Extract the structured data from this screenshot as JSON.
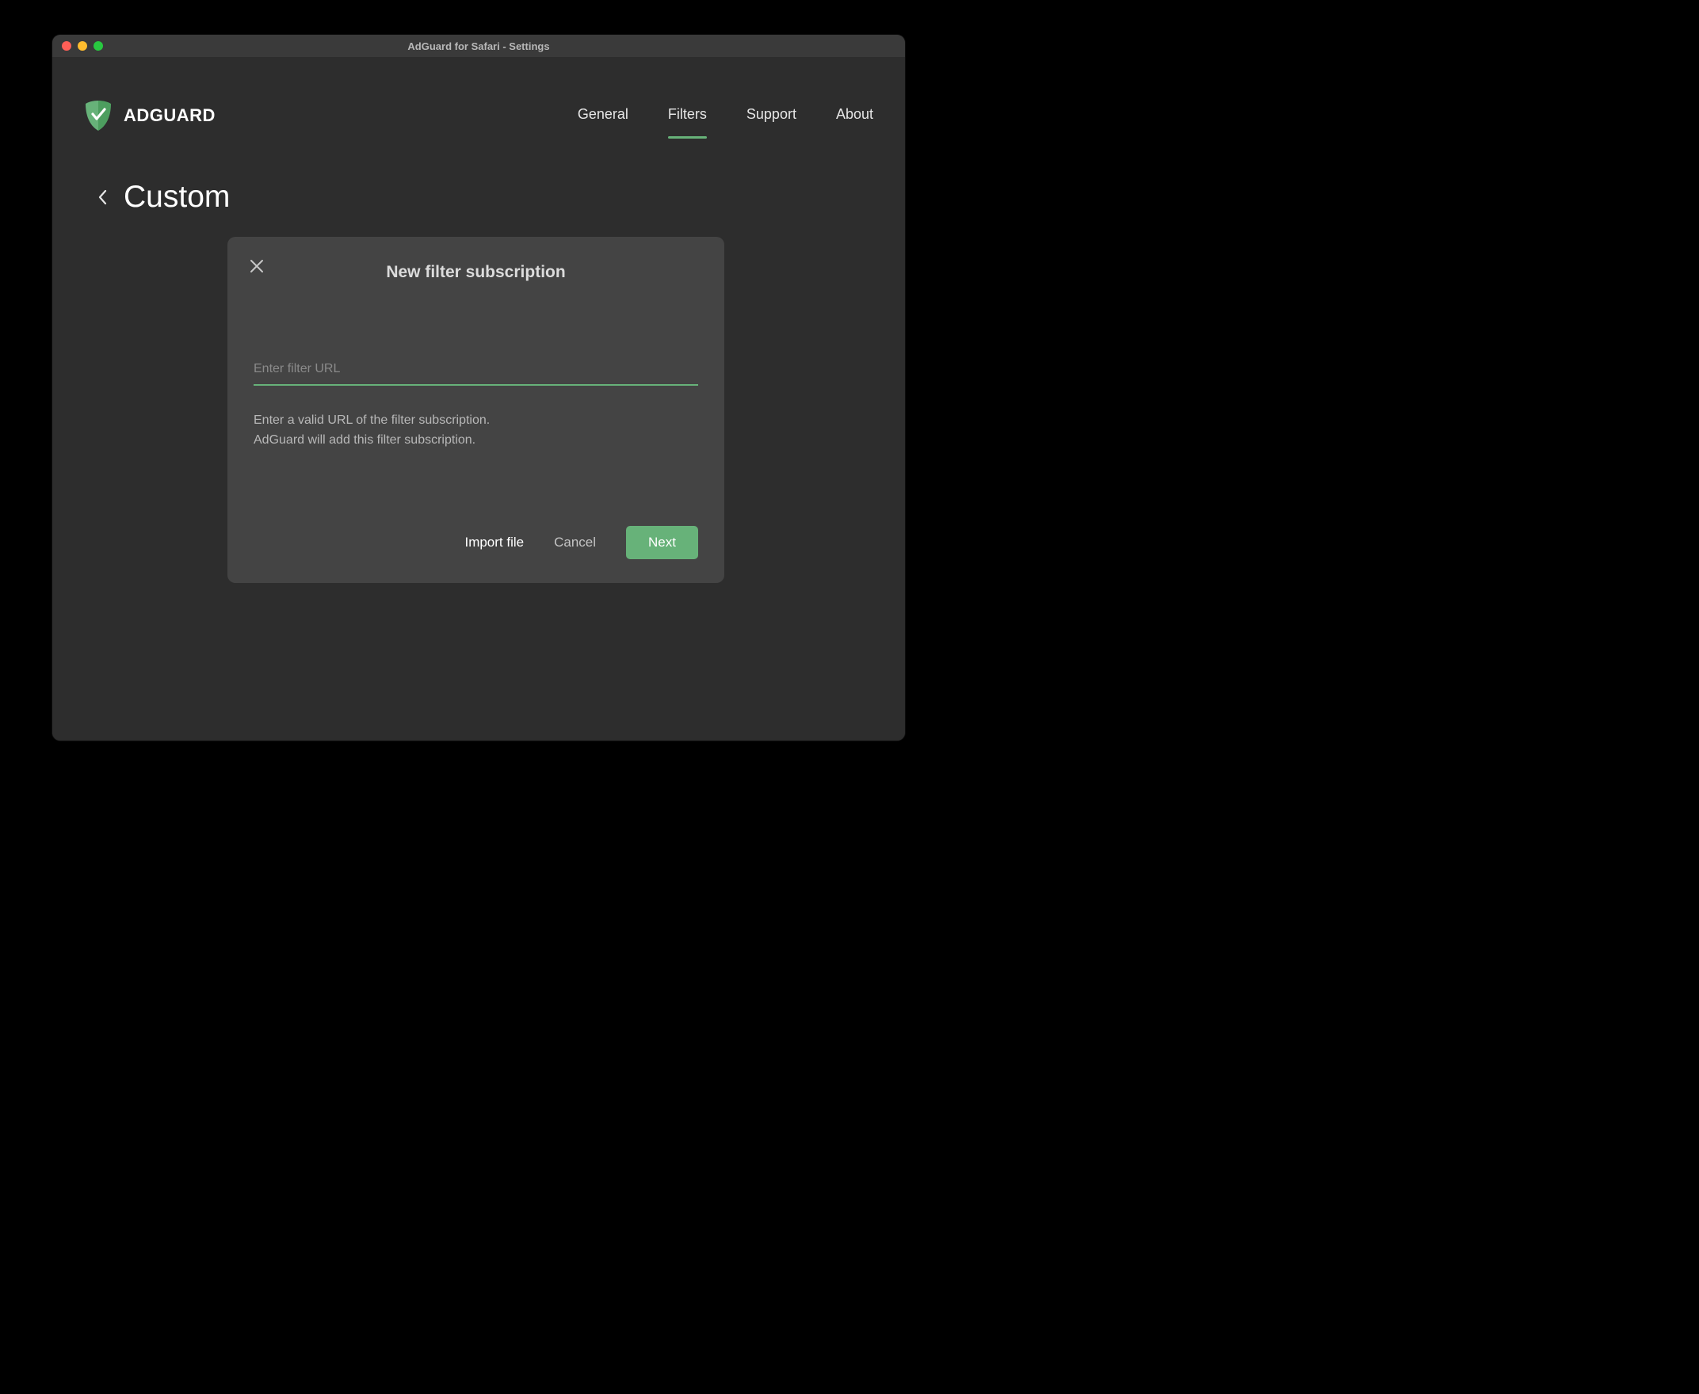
{
  "window": {
    "title": "AdGuard for Safari - Settings"
  },
  "brand": {
    "name": "ADGUARD"
  },
  "nav": {
    "items": [
      {
        "label": "General",
        "active": false
      },
      {
        "label": "Filters",
        "active": true
      },
      {
        "label": "Support",
        "active": false
      },
      {
        "label": "About",
        "active": false
      }
    ]
  },
  "page": {
    "title": "Custom"
  },
  "modal": {
    "title": "New filter subscription",
    "input_placeholder": "Enter filter URL",
    "input_value": "",
    "help_line1": "Enter a valid URL of the filter subscription.",
    "help_line2": "AdGuard will add this filter subscription.",
    "buttons": {
      "import": "Import file",
      "cancel": "Cancel",
      "next": "Next"
    }
  },
  "colors": {
    "accent": "#67b279",
    "window_bg": "#2d2d2d",
    "modal_bg": "#444444"
  }
}
